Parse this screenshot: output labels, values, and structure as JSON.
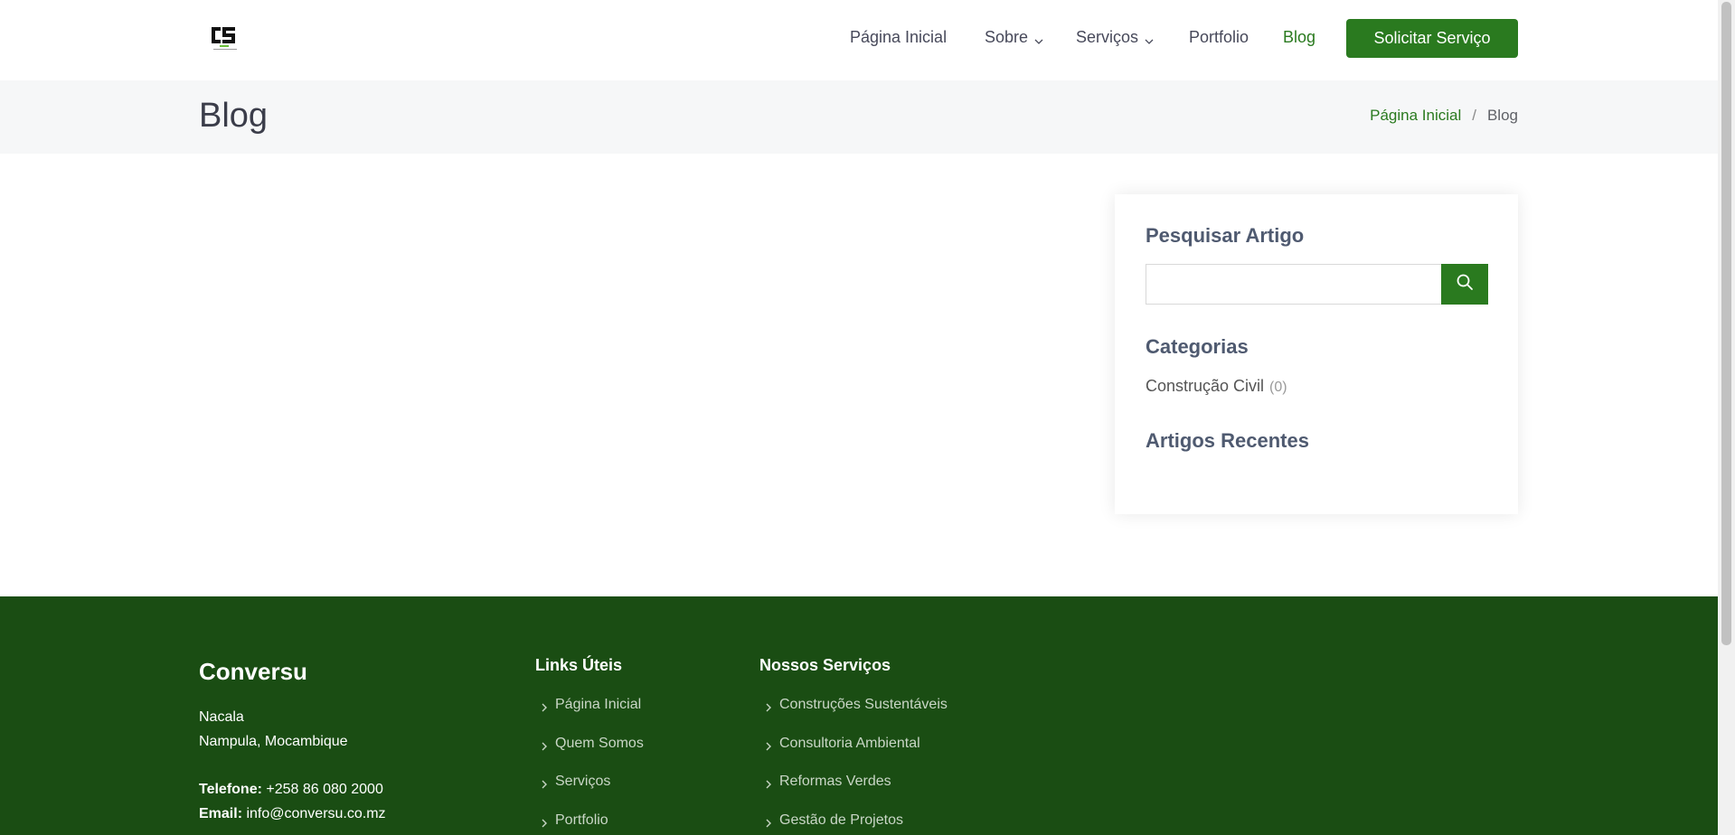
{
  "header": {
    "logo_icon": "cs-logo",
    "nav": [
      {
        "label": "Página Inicial",
        "dropdown": false,
        "active": false
      },
      {
        "label": "Sobre",
        "dropdown": true,
        "active": false
      },
      {
        "label": "Serviços",
        "dropdown": true,
        "active": false
      },
      {
        "label": "Portfolio",
        "dropdown": false,
        "active": false
      },
      {
        "label": "Blog",
        "dropdown": false,
        "active": true
      }
    ],
    "cta_label": "Solicitar Serviço"
  },
  "breadcrumb": {
    "title": "Blog",
    "home": "Página Inicial",
    "separator": "/",
    "current": "Blog"
  },
  "sidebar": {
    "search_heading": "Pesquisar Artigo",
    "search_value": "",
    "search_icon": "search-icon",
    "categories_heading": "Categorias",
    "category": {
      "name": "Construção Civil",
      "count": "(0)"
    },
    "recent_heading": "Artigos Recentes"
  },
  "footer": {
    "brand": "Conversu",
    "address_line1": "Nacala",
    "address_line2": "Nampula, Mocambique",
    "phone_label": "Telefone:",
    "phone": "+258 86 080 2000",
    "email_label": "Email:",
    "email": "info@conversu.co.mz",
    "links_heading": "Links Úteis",
    "links": [
      "Página Inicial",
      "Quem Somos",
      "Serviços",
      "Portfolio"
    ],
    "services_heading": "Nossos Serviços",
    "services": [
      "Construções Sustentáveis",
      "Consultoria Ambiental",
      "Reformas Verdes",
      "Gestão de Projetos"
    ]
  },
  "colors": {
    "brand_green": "#2a7a1f",
    "footer_green": "#1a4d13",
    "nav_text": "#47495a"
  }
}
